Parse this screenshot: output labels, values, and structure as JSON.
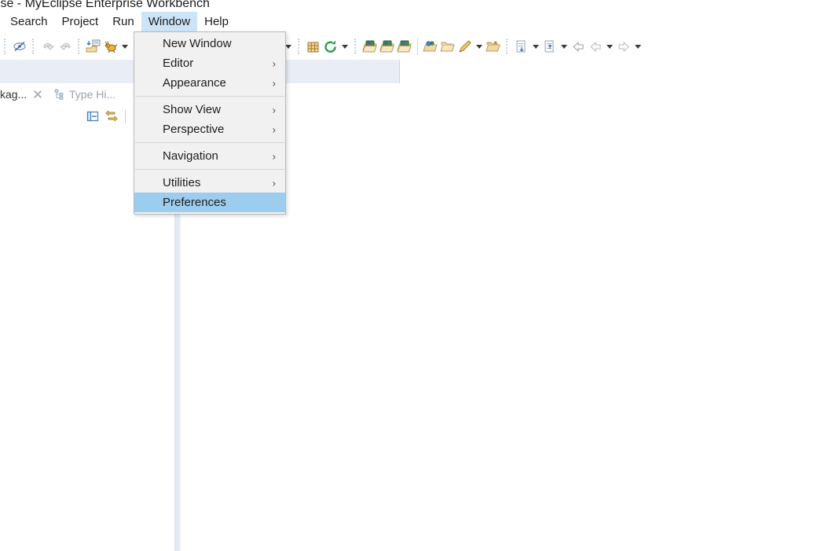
{
  "window": {
    "title": "terprise - MyEclipse Enterprise Workbench"
  },
  "menubar": {
    "items": [
      {
        "label": "Search",
        "active": false
      },
      {
        "label": "Project",
        "active": false
      },
      {
        "label": "Run",
        "active": false
      },
      {
        "label": "Window",
        "active": true
      },
      {
        "label": "Help",
        "active": false
      }
    ]
  },
  "window_menu": {
    "items": [
      {
        "label": "New Window",
        "submenu": false,
        "selected": false,
        "separator_after": false
      },
      {
        "label": "Editor",
        "submenu": true,
        "selected": false,
        "separator_after": false
      },
      {
        "label": "Appearance",
        "submenu": true,
        "selected": false,
        "separator_after": true
      },
      {
        "label": "Show View",
        "submenu": true,
        "selected": false,
        "separator_after": false
      },
      {
        "label": "Perspective",
        "submenu": true,
        "selected": false,
        "separator_after": true
      },
      {
        "label": "Navigation",
        "submenu": true,
        "selected": false,
        "separator_after": true
      },
      {
        "label": "Utilities",
        "submenu": true,
        "selected": false,
        "separator_after": false
      },
      {
        "label": "Preferences",
        "submenu": false,
        "selected": true,
        "separator_after": false
      }
    ],
    "chevron_glyph": "›"
  },
  "view_tabs": [
    {
      "label": "kag...",
      "active": true,
      "closable": true,
      "icon": "package-explorer-icon"
    },
    {
      "label": "Type Hi...",
      "active": false,
      "closable": false,
      "icon": "type-hierarchy-icon"
    }
  ],
  "view_toolbar": {
    "buttons": [
      {
        "icon": "collapse-all-icon"
      },
      {
        "icon": "link-with-editor-icon"
      }
    ]
  },
  "toolbar": {
    "groups": [
      {
        "items": [
          {
            "icon": "toggle-mark-occurrences-icon",
            "type": "button"
          }
        ]
      },
      {
        "items": [
          {
            "icon": "undo-icon",
            "type": "button"
          },
          {
            "icon": "redo-icon",
            "type": "button"
          }
        ]
      },
      {
        "items": [
          {
            "icon": "import-icon",
            "type": "button"
          },
          {
            "icon": "debug-ant-icon",
            "type": "button"
          },
          {
            "icon": "dropdown-arrow",
            "type": "arrow"
          }
        ]
      },
      {
        "items": [
          {
            "icon": "new-wizard-icon",
            "type": "button",
            "pressed": true
          },
          {
            "icon": "dropdown-arrow",
            "type": "arrow"
          }
        ]
      },
      {
        "items": [
          {
            "icon": "debug-icon",
            "type": "button"
          },
          {
            "icon": "dropdown-arrow",
            "type": "arrow"
          },
          {
            "icon": "run-icon",
            "type": "button"
          },
          {
            "icon": "dropdown-arrow",
            "type": "arrow"
          },
          {
            "icon": "run-external-tools-icon",
            "type": "button"
          },
          {
            "icon": "dropdown-arrow",
            "type": "arrow"
          },
          {
            "icon": "run-server-icon",
            "type": "button"
          },
          {
            "icon": "dropdown-arrow",
            "type": "arrow"
          }
        ]
      },
      {
        "items": [
          {
            "icon": "new-package-icon",
            "type": "button"
          },
          {
            "icon": "refresh-icon",
            "type": "button"
          },
          {
            "icon": "dropdown-arrow",
            "type": "arrow"
          }
        ]
      },
      {
        "items": [
          {
            "icon": "open-type-icon",
            "type": "button"
          },
          {
            "icon": "open-type-2-icon",
            "type": "button"
          },
          {
            "icon": "open-type-3-icon",
            "type": "button"
          },
          {
            "icon": "separator-line",
            "type": "line"
          },
          {
            "icon": "open-resource-icon",
            "type": "button"
          },
          {
            "icon": "new-folder-icon",
            "type": "button"
          },
          {
            "icon": "edit-pencil-icon",
            "type": "button"
          },
          {
            "icon": "dropdown-arrow",
            "type": "arrow"
          },
          {
            "icon": "open-file-icon",
            "type": "button"
          }
        ]
      },
      {
        "items": [
          {
            "icon": "next-annotation-icon",
            "type": "button"
          },
          {
            "icon": "dropdown-arrow",
            "type": "arrow"
          },
          {
            "icon": "previous-annotation-icon",
            "type": "button"
          },
          {
            "icon": "dropdown-arrow",
            "type": "arrow"
          },
          {
            "icon": "back-icon",
            "type": "button"
          },
          {
            "icon": "back-history-icon",
            "type": "button"
          },
          {
            "icon": "dropdown-arrow",
            "type": "arrow"
          },
          {
            "icon": "forward-icon",
            "type": "button"
          },
          {
            "icon": "dropdown-arrow",
            "type": "arrow"
          }
        ]
      }
    ]
  },
  "colors": {
    "menu_highlight": "#9ccdef",
    "menubar_highlight": "#cce4f7",
    "menu_background": "#f1f1f1",
    "band": "#e8edf6",
    "sash": "#e4eaf5",
    "text": "#1d1d1d"
  }
}
